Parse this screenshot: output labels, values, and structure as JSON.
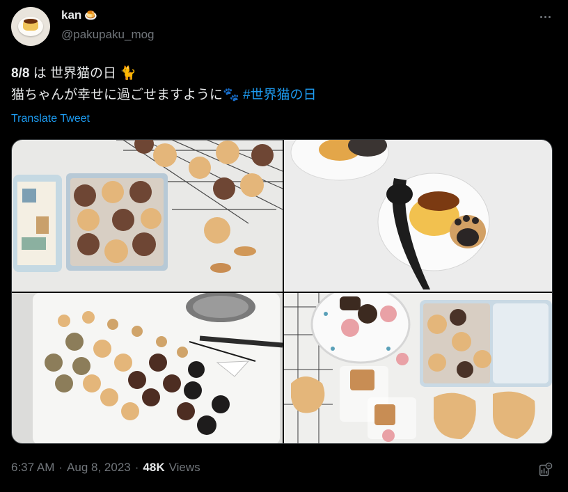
{
  "author": {
    "display_name": "kan",
    "name_emoji": "🍮",
    "handle": "@pakupaku_mog"
  },
  "tweet": {
    "line1_date": "8/8",
    "line1_rest": " は 世界猫の日 🐈",
    "line2_text": "猫ちゃんが幸せに過ごせますように🐾 ",
    "hashtag": "#世界猫の日",
    "translate_label": "Translate Tweet"
  },
  "media": [
    {
      "icon": "photo-cat-cookies-tin"
    },
    {
      "icon": "photo-pudding-plate"
    },
    {
      "icon": "photo-cookies-board"
    },
    {
      "icon": "photo-cookies-spread"
    }
  ],
  "meta": {
    "time": "6:37 AM",
    "sep1": "·",
    "date": "Aug 8, 2023",
    "sep2": "·",
    "views_count": "48K",
    "views_label": "Views"
  },
  "colors": {
    "background": "#000000",
    "text": "#e7e9ea",
    "secondary": "#71767b",
    "link": "#1d9bf0"
  }
}
